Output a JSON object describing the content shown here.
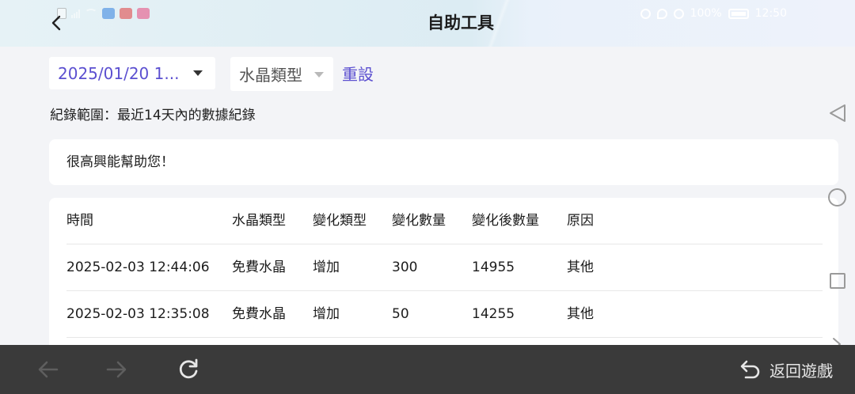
{
  "header": {
    "title": "自助工具",
    "status_right_text": "100%",
    "time": "12:50"
  },
  "filters": {
    "date_value": "2025/01/20 1...",
    "crystal_type_placeholder": "水晶類型",
    "reset_label": "重設"
  },
  "range_note": "紀錄範圍：最近14天內的數據紀錄",
  "message": "很高興能幫助您！",
  "table": {
    "headers": [
      "時間",
      "水晶類型",
      "變化類型",
      "變化數量",
      "變化後數量",
      "原因"
    ],
    "rows": [
      [
        "2025-02-03 12:44:06",
        "免費水晶",
        "增加",
        "300",
        "14955",
        "其他"
      ],
      [
        "2025-02-03 12:35:08",
        "免費水晶",
        "增加",
        "50",
        "14255",
        "其他"
      ]
    ]
  },
  "toolbar": {
    "return_label": "返回遊戲"
  },
  "icons": {
    "back": "chevron-left-icon",
    "date_caret": "caret-down-icon",
    "type_caret": "caret-down-icon",
    "nav_back": "triangle-back-icon",
    "nav_home": "circle-home-icon",
    "nav_recent": "square-recent-icon",
    "browser_back": "arrow-left-icon",
    "browser_forward": "arrow-right-icon",
    "reload": "reload-icon",
    "return_game": "return-arrow-icon"
  },
  "colors": {
    "accent": "#5b4fd0",
    "toolbar_bg": "#3a3a3a",
    "page_bg": "#f3f4f7"
  }
}
